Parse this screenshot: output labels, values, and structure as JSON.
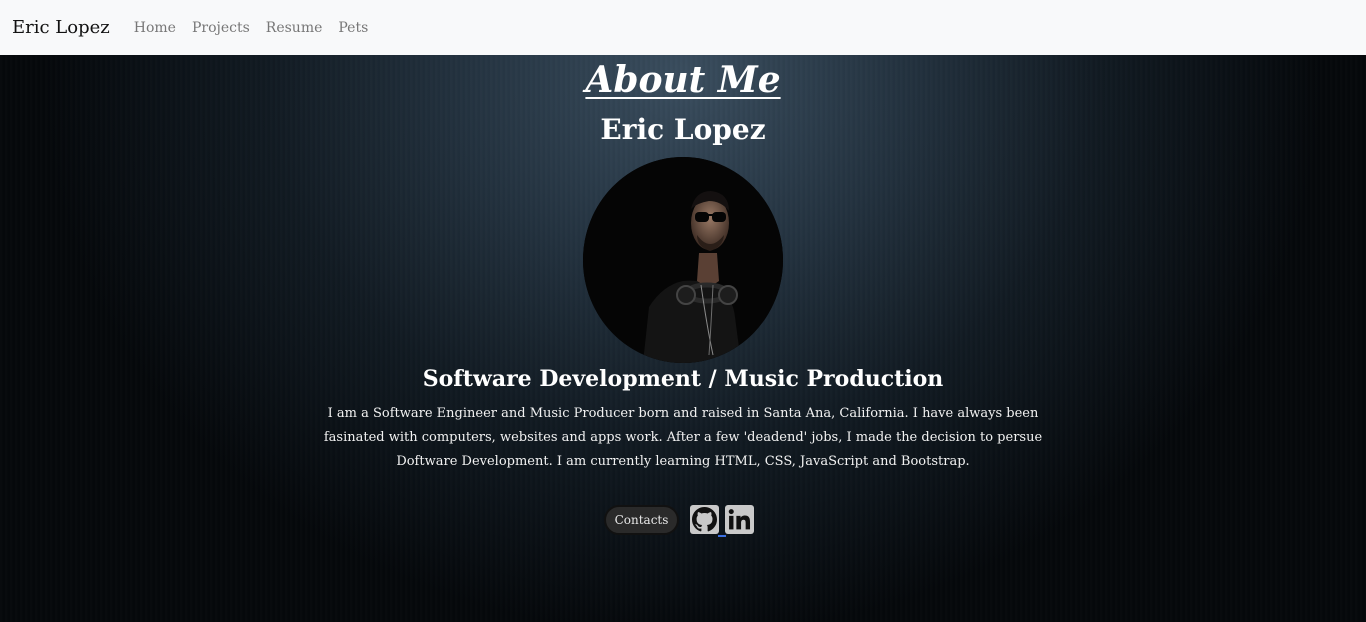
{
  "navbar": {
    "brand": "Eric Lopez",
    "links": [
      "Home",
      "Projects",
      "Resume",
      "Pets"
    ]
  },
  "about": {
    "title": "About Me",
    "name": "Eric Lopez",
    "subtitle": "Software Development / Music Production",
    "bio": "I am a Software Engineer and Music Producer born and raised in Santa Ana, California. I have always been fasinated with computers, websites and apps work. After a few 'deadend' jobs, I made the decision to persue Doftware Development. I am currently learning HTML, CSS, JavaScript and Bootstrap."
  },
  "actions": {
    "contacts_label": "Contacts",
    "social_icons": [
      "github-icon",
      "linkedin-icon"
    ]
  },
  "colors": {
    "navbar_bg": "#f8f9fa",
    "hero_center": "#3a4d5e",
    "hero_edge": "#05080b",
    "text": "#ffffff",
    "nav_link": "#777777",
    "social_icon_bg": "#c9c9c9"
  }
}
